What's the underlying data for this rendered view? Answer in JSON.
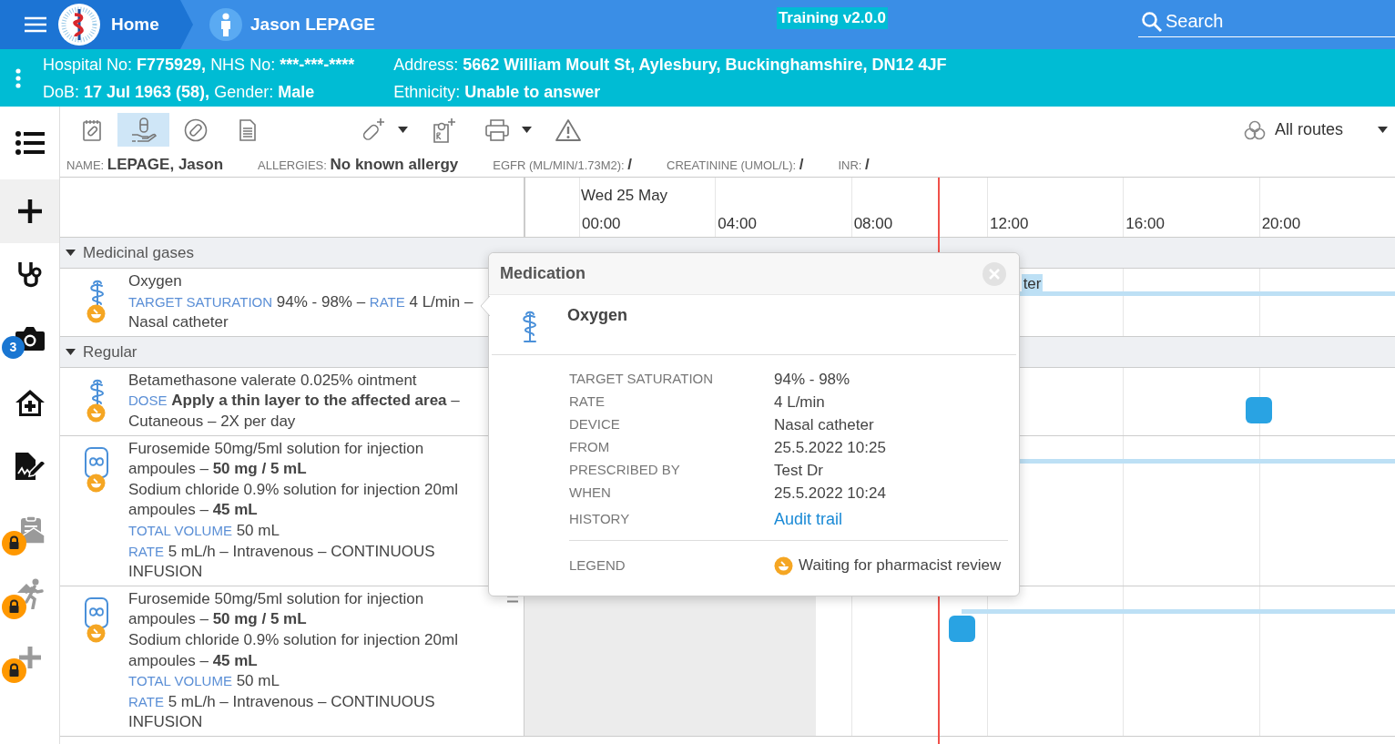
{
  "navbar": {
    "home": "Home",
    "patient": "Jason LEPAGE",
    "environment": "Training v2.0.0",
    "search": {
      "placeholder": "Search"
    }
  },
  "banner": {
    "columns": [
      [
        [
          {
            "label": "Hospital No:",
            "value": "F775929,"
          },
          {
            "label": "NHS No:",
            "value": "***-***-****"
          }
        ],
        [
          {
            "label": "DoB:",
            "value": "17 Jul 1963 (58),"
          },
          {
            "label": "Gender:",
            "value": "Male"
          }
        ]
      ],
      [
        [
          {
            "label": "Address:",
            "value": "5662 William Moult St, Aylesbury, Buckinghamshire, DN12 4JF"
          }
        ],
        [
          {
            "label": "Ethnicity:",
            "value": "Unable to answer"
          }
        ]
      ]
    ]
  },
  "sidebar": {
    "items": [
      {
        "kind": "list",
        "selected": false,
        "locked": false
      },
      {
        "kind": "add",
        "selected": true,
        "locked": false
      },
      {
        "kind": "stethoscope",
        "selected": false,
        "locked": false
      },
      {
        "kind": "camera",
        "selected": false,
        "locked": false,
        "badge": "3"
      },
      {
        "kind": "home",
        "selected": false,
        "locked": false
      },
      {
        "kind": "signature",
        "selected": false,
        "locked": false
      },
      {
        "kind": "clipboard",
        "selected": false,
        "locked": true
      },
      {
        "kind": "walking",
        "selected": false,
        "locked": true
      },
      {
        "kind": "plus",
        "selected": false,
        "locked": true
      }
    ]
  },
  "toolbar": {
    "view_buttons": [
      {
        "kind": "chart",
        "selected": false
      },
      {
        "kind": "pill-hand",
        "selected": true
      },
      {
        "kind": "pill",
        "selected": false
      },
      {
        "kind": "document",
        "selected": false
      }
    ],
    "action_buttons": [
      {
        "kind": "add-pill",
        "dropdown": true
      },
      {
        "kind": "ref",
        "dropdown": false
      },
      {
        "kind": "print",
        "dropdown": true
      },
      {
        "kind": "warning",
        "dropdown": false
      }
    ],
    "routes": "All routes"
  },
  "patient_info": [
    {
      "label": "NAME:",
      "value": "LEPAGE, Jason"
    },
    {
      "label": "ALLERGIES:",
      "value": "No known allergy"
    },
    {
      "label": "EGFR (ML/MIN/1.73M2):",
      "value": "/"
    },
    {
      "label": "CREATININE (UMOL/L):",
      "value": "/"
    },
    {
      "label": "INR:",
      "value": "/"
    }
  ],
  "timeline": {
    "date": "Wed 25 May",
    "times": [
      "00:00",
      "04:00",
      "08:00",
      "12:00",
      "16:00",
      "20:00"
    ],
    "groups": [
      {
        "name": "Medicinal gases",
        "expanded": true,
        "medications": [
          {
            "kind": "gas",
            "pending_review": true,
            "drag_handle": false,
            "shaded": false,
            "name": "Oxygen",
            "lines": [
              [
                {
                  "label": "TARGET SATURATION"
                },
                {
                  "text": "94% - 98% –"
                },
                {
                  "label": "RATE"
                },
                {
                  "text": "4 L/min –"
                }
              ],
              [
                {
                  "text": "Nasal catheter"
                }
              ]
            ],
            "events": [
              {
                "kind": "bar"
              },
              {
                "kind": "label",
                "text": "ter"
              }
            ]
          }
        ]
      },
      {
        "name": "Regular",
        "expanded": true,
        "medications": [
          {
            "kind": "topical",
            "pending_review": true,
            "drag_handle": false,
            "shaded": false,
            "name": "Betamethasone valerate 0.025% ointment",
            "lines": [
              [
                {
                  "label": "DOSE"
                },
                {
                  "text": "**Apply a thin layer to the affected area** –"
                }
              ],
              [
                {
                  "text": "Cutaneous – 2X per day"
                }
              ]
            ],
            "events": [
              {
                "kind": "dose"
              }
            ]
          },
          {
            "kind": "infusion",
            "pending_review": true,
            "drag_handle": false,
            "shaded": false,
            "name": "Furosemide 50mg/5ml solution for injection",
            "lines": [
              [
                {
                  "text": "ampoules – **50 mg / 5 mL**"
                }
              ],
              [
                {
                  "text": "Sodium chloride 0.9% solution for injection 20ml"
                }
              ],
              [
                {
                  "text": "ampoules – **45 mL**"
                }
              ],
              [
                {
                  "label": "TOTAL VOLUME"
                },
                {
                  "text": "50 mL"
                }
              ],
              [
                {
                  "label": "RATE"
                },
                {
                  "text": "5 mL/h – Intravenous – CONTINUOUS"
                }
              ],
              [
                {
                  "text": "INFUSION"
                }
              ]
            ],
            "events": [
              {
                "kind": "bar"
              }
            ]
          },
          {
            "kind": "infusion",
            "pending_review": true,
            "drag_handle": true,
            "shaded": true,
            "name": "Furosemide 50mg/5ml solution for injection",
            "lines": [
              [
                {
                  "text": "ampoules – **50 mg / 5 mL**"
                }
              ],
              [
                {
                  "text": "Sodium chloride 0.9% solution for injection 20ml"
                }
              ],
              [
                {
                  "text": "ampoules – **45 mL**"
                }
              ],
              [
                {
                  "label": "TOTAL VOLUME"
                },
                {
                  "text": "50 mL"
                }
              ],
              [
                {
                  "label": "RATE"
                },
                {
                  "text": "5 mL/h – Intravenous – CONTINUOUS"
                }
              ],
              [
                {
                  "text": "INFUSION"
                }
              ]
            ],
            "events": [
              {
                "kind": "bar"
              },
              {
                "kind": "dose"
              }
            ]
          }
        ]
      }
    ]
  },
  "popup": {
    "title": "Medication",
    "kind": "gas",
    "name": "Oxygen",
    "details": [
      {
        "kind": "text",
        "label": "TARGET SATURATION",
        "value": "94% - 98%"
      },
      {
        "kind": "text",
        "label": "RATE",
        "value": "4 L/min"
      },
      {
        "kind": "text",
        "label": "DEVICE",
        "value": "Nasal catheter"
      },
      {
        "kind": "text",
        "label": "FROM",
        "value": "25.5.2022 10:25"
      },
      {
        "kind": "text",
        "label": "PRESCRIBED BY",
        "value": "Test Dr"
      },
      {
        "kind": "text",
        "label": "WHEN",
        "value": "25.5.2022 10:24"
      },
      {
        "kind": "link",
        "label": "HISTORY",
        "value": "Audit trail"
      }
    ],
    "legend": {
      "label": "LEGEND",
      "text": "Waiting for pharmacist review"
    }
  }
}
